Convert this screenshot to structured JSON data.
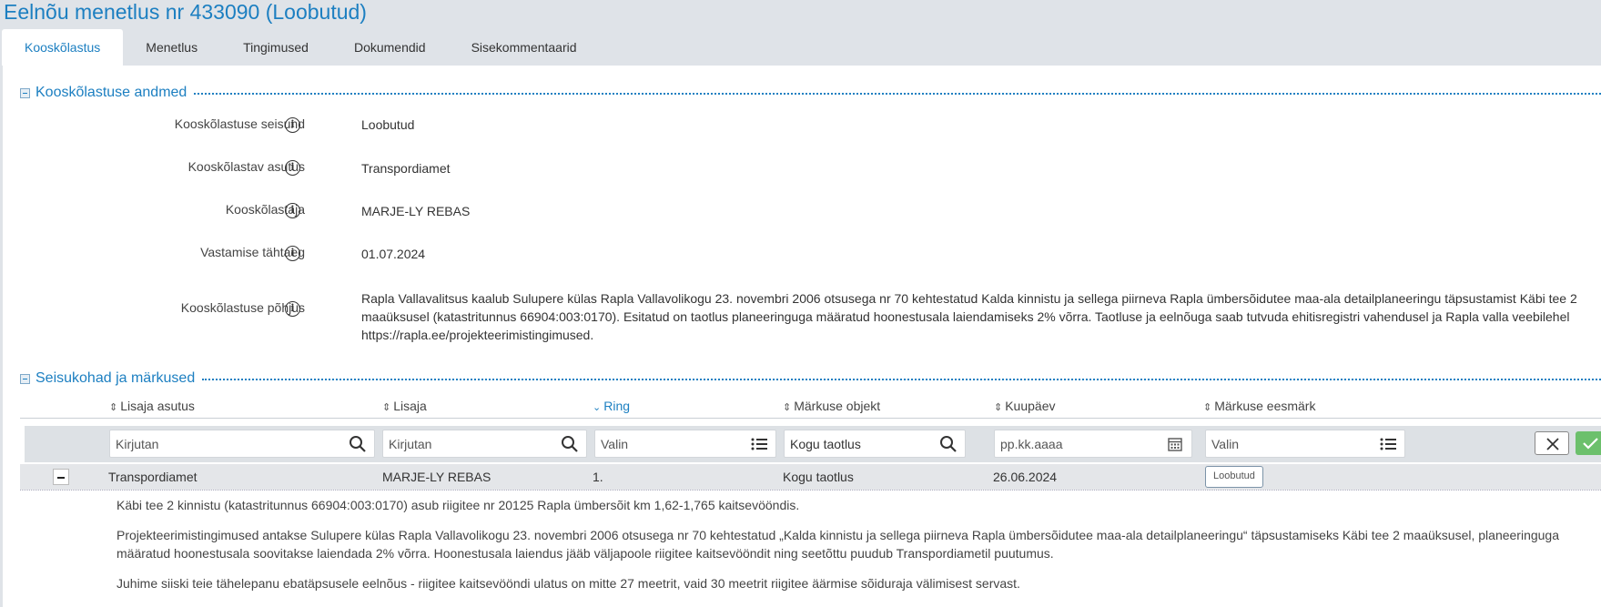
{
  "page": {
    "title": "Eelnõu menetlus nr 433090 (Loobutud)"
  },
  "tabs": [
    {
      "label": "Kooskõlastus",
      "active": true
    },
    {
      "label": "Menetlus"
    },
    {
      "label": "Tingimused"
    },
    {
      "label": "Dokumendid"
    },
    {
      "label": "Sisekommentaarid"
    }
  ],
  "agreement_section": {
    "title": "Kooskõlastuse andmed",
    "fields": [
      {
        "label": "Kooskõlastuse seisund",
        "value": "Loobutud"
      },
      {
        "label": "Kooskõlastav asutus",
        "value": "Transpordiamet"
      },
      {
        "label": "Kooskõlastaja",
        "value": "MARJE-LY REBAS"
      },
      {
        "label": "Vastamise tähtaeg",
        "value": "01.07.2024"
      },
      {
        "label": "Kooskõlastuse põhjus",
        "value": "Rapla Vallavalitsus kaalub Sulupere külas Rapla Vallavolikogu 23. novembri 2006 otsusega nr 70 kehtestatud Kalda kinnistu ja sellega piirneva Rapla ümbersõidutee maa-ala detailplaneeringu täpsustamist Käbi tee 2 maaüksusel (katastritunnus 66904:003:0170). Esitatud on taotlus planeeringuga määratud hoonestusala laiendamiseks 2% võrra. Taotluse ja eelnõuga saab tutvuda ehitisregistri vahendusel ja Rapla valla veebilehel https://rapla.ee/projekteerimistingimused."
      }
    ]
  },
  "remarks_section": {
    "title": "Seisukohad ja märkused",
    "columns": [
      {
        "label": "Lisaja asutus",
        "sort_icon": "sort-both-icon"
      },
      {
        "label": "Lisaja",
        "sort_icon": "sort-both-icon"
      },
      {
        "label": "Ring",
        "sort_icon": "sort-desc-icon",
        "active": true
      },
      {
        "label": "Märkuse objekt",
        "sort_icon": "sort-both-icon"
      },
      {
        "label": "Kuupäev",
        "sort_icon": "sort-both-icon"
      },
      {
        "label": "Märkuse eesmärk",
        "sort_icon": "sort-both-icon"
      }
    ],
    "filters": [
      {
        "placeholder": "Kirjutan",
        "icon": "search-icon"
      },
      {
        "placeholder": "Kirjutan",
        "icon": "search-icon"
      },
      {
        "placeholder": "Valin",
        "icon": "list-icon"
      },
      {
        "value": "Kogu taotlus",
        "icon": "search-icon"
      },
      {
        "placeholder": "pp.kk.aaaa",
        "icon": "calendar-icon"
      },
      {
        "placeholder": "Valin",
        "icon": "list-icon"
      }
    ],
    "rows": [
      {
        "lisaja_asutus": "Transpordiamet",
        "lisaja": "MARJE-LY REBAS",
        "ring": "1.",
        "objekt": "Kogu taotlus",
        "kuupaev": "26.06.2024",
        "eesmark": "Loobutud",
        "comments": [
          "Käbi tee 2 kinnistu (katastritunnus 66904:003:0170) asub riigitee nr 20125 Rapla ümbersõit km 1,62-1,765 kaitsevööndis.",
          "Projekteerimistingimused antakse Sulupere külas Rapla Vallavolikogu 23. novembri 2006 otsusega nr 70 kehtestatud „Kalda kinnistu ja sellega piirneva Rapla ümbersõidutee maa-ala detailplaneeringu“ täpsustamiseks Käbi tee 2 maaüksusel, planeeringuga määratud hoonestusala soovitakse laiendada 2% võrra. Hoonestusala laiendus jääb väljapoole riigitee kaitsevööndit ning seetõttu puudub Transpordiametil puutumus.",
          "Juhime siiski teie tähelepanu  ebatäpsusele eelnõus - riigitee kaitsevööndi ulatus on mitte 27 meetrit, vaid 30 meetrit riigitee äärmise sõiduraja välimisest servast."
        ]
      }
    ]
  },
  "colors": {
    "accent": "#1c7fc1",
    "topbar": "#dfe3e8",
    "filter_bar": "#dde1e5",
    "ok_button": "#6cc06c"
  }
}
